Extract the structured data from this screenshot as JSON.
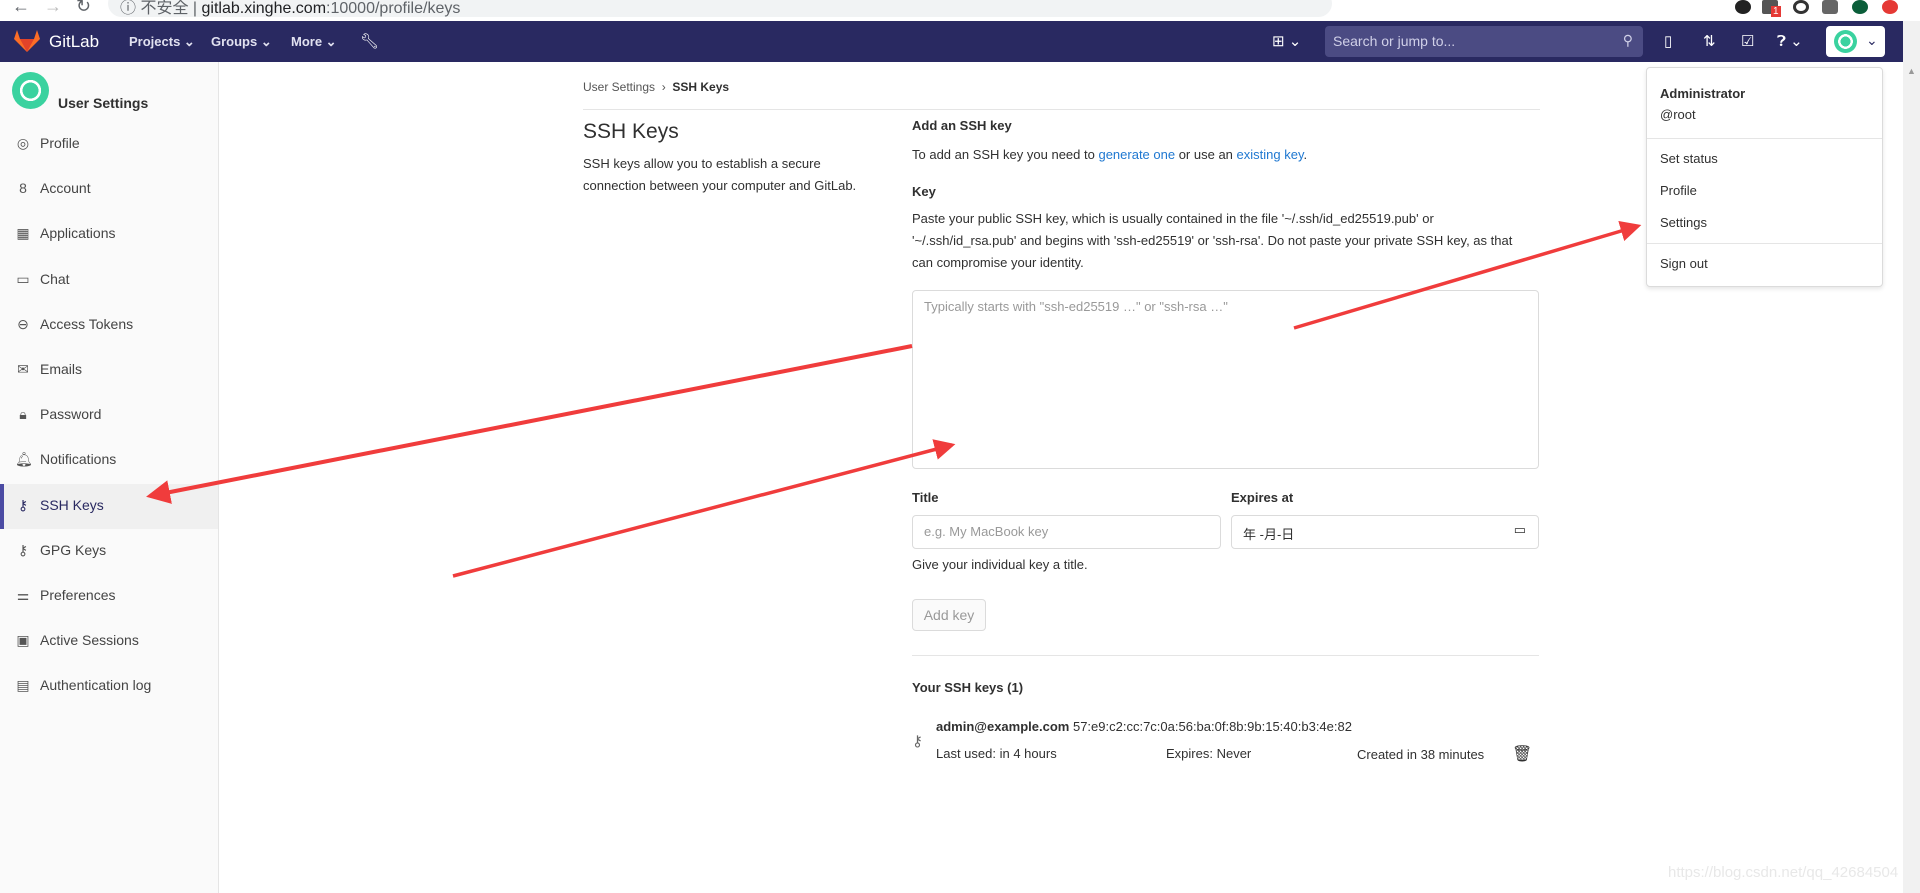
{
  "browser": {
    "url_security": "不安全",
    "url_host": "gitlab.xinghe.com",
    "url_path": ":10000/profile/keys",
    "ext_badge": "1"
  },
  "navbar": {
    "brand": "GitLab",
    "links": [
      "Projects",
      "Groups",
      "More"
    ],
    "search_placeholder": "Search or jump to..."
  },
  "sidebar": {
    "title": "User Settings",
    "items": [
      {
        "label": "Profile",
        "icon": "profile-icon",
        "glyph": "◎"
      },
      {
        "label": "Account",
        "icon": "account-icon",
        "glyph": "8"
      },
      {
        "label": "Applications",
        "icon": "applications-icon",
        "glyph": "▦"
      },
      {
        "label": "Chat",
        "icon": "chat-icon",
        "glyph": "▭"
      },
      {
        "label": "Access Tokens",
        "icon": "token-icon",
        "glyph": "⊖"
      },
      {
        "label": "Emails",
        "icon": "mail-icon",
        "glyph": "✉"
      },
      {
        "label": "Password",
        "icon": "lock-icon",
        "glyph": "🔒︎"
      },
      {
        "label": "Notifications",
        "icon": "bell-icon",
        "glyph": "🔔︎"
      },
      {
        "label": "SSH Keys",
        "icon": "key-icon",
        "glyph": "⚷",
        "active": true
      },
      {
        "label": "GPG Keys",
        "icon": "key-icon",
        "glyph": "⚷"
      },
      {
        "label": "Preferences",
        "icon": "preferences-icon",
        "glyph": "⚌"
      },
      {
        "label": "Active Sessions",
        "icon": "monitor-icon",
        "glyph": "▣"
      },
      {
        "label": "Authentication log",
        "icon": "log-icon",
        "glyph": "▤"
      }
    ]
  },
  "breadcrumb": {
    "parent": "User Settings",
    "current": "SSH Keys"
  },
  "intro": {
    "title": "SSH Keys",
    "description": "SSH keys allow you to establish a secure connection between your computer and GitLab."
  },
  "form": {
    "heading": "Add an SSH key",
    "help_pre": "To add an SSH key you need to ",
    "help_link1": "generate one",
    "help_mid": " or use an ",
    "help_link2": "existing key",
    "help_post": ".",
    "key_label": "Key",
    "key_help": "Paste your public SSH key, which is usually contained in the file '~/.ssh/id_ed25519.pub' or '~/.ssh/id_rsa.pub' and begins with 'ssh-ed25519' or 'ssh-rsa'. Do not paste your private SSH key, as that can compromise your identity.",
    "key_placeholder": "Typically starts with \"ssh-ed25519 …\" or \"ssh-rsa …\"",
    "title_label": "Title",
    "title_placeholder": "e.g. My MacBook key",
    "title_help": "Give your individual key a title.",
    "expires_label": "Expires at",
    "expires_value": "年 -月-日",
    "submit": "Add key"
  },
  "keys": {
    "heading": "Your SSH keys (1)",
    "items": [
      {
        "title": "admin@example.com",
        "fingerprint": "57:e9:c2:cc:7c:0a:56:ba:0f:8b:9b:15:40:b3:4e:82",
        "last_used": "Last used: in 4 hours",
        "expires": "Expires: Never",
        "created": "Created in 38 minutes"
      }
    ]
  },
  "user_menu": {
    "name": "Administrator",
    "username": "@root",
    "items": [
      "Set status",
      "Profile",
      "Settings",
      "Sign out"
    ]
  },
  "watermark": "https://blog.csdn.net/qq_42684504",
  "colors": {
    "navbar": "#292961",
    "accent": "#1f78d1",
    "annotation_arrow": "#f03c3c"
  }
}
